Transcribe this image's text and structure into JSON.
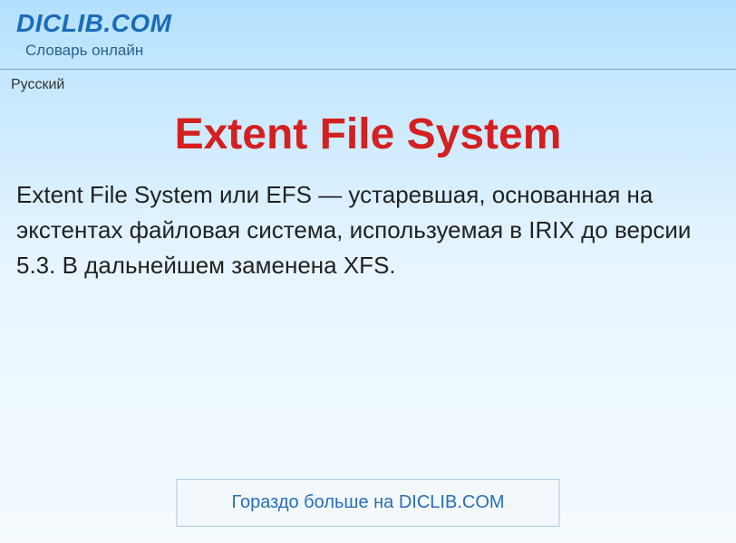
{
  "header": {
    "site_name": "DICLIB.COM",
    "tagline": "Словарь онлайн"
  },
  "language_label": "Русский",
  "article": {
    "title": "Extent File System",
    "body": "Extent File System или EFS — устаревшая, основанная на экстентах файловая система, используемая в IRIX до версии 5.3. В дальнейшем заменена XFS."
  },
  "cta": {
    "label": "Гораздо больше на DICLIB.COM"
  }
}
